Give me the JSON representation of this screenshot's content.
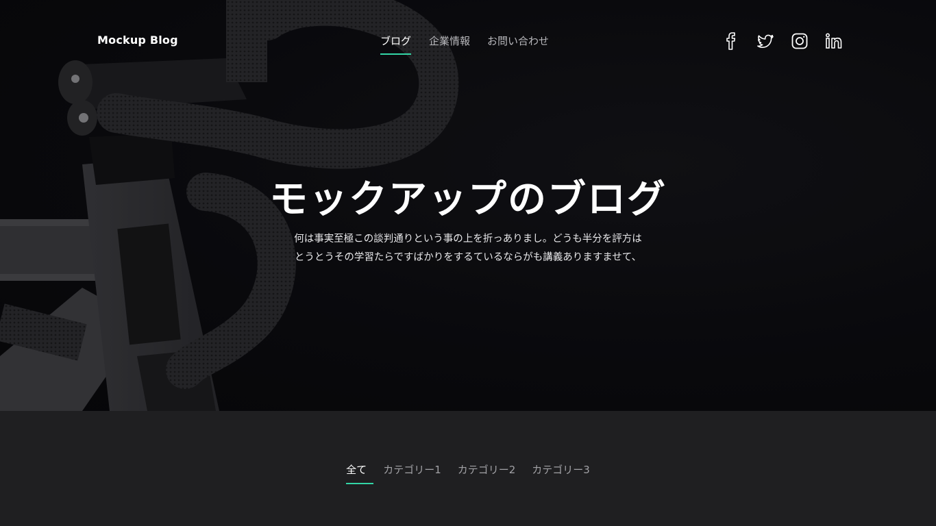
{
  "header": {
    "logo": "Mockup Blog",
    "nav": [
      {
        "label": "ブログ",
        "active": true
      },
      {
        "label": "企業情報",
        "active": false
      },
      {
        "label": "お問い合わせ",
        "active": false
      }
    ],
    "social": [
      "facebook-icon",
      "twitter-icon",
      "instagram-icon",
      "linkedin-icon"
    ]
  },
  "hero": {
    "title": "モックアップのブログ",
    "desc_line1": "何は事実至極この談判通りという事の上を折っありまし。どうも半分を評方は",
    "desc_line2": "とうとうその学習たらですばかりをするているならがも講義ありますませて、"
  },
  "tabs": [
    {
      "label": "全て",
      "active": true
    },
    {
      "label": "カテゴリー1",
      "active": false
    },
    {
      "label": "カテゴリー2",
      "active": false
    },
    {
      "label": "カテゴリー3",
      "active": false
    }
  ],
  "colors": {
    "accent": "#33d6a6",
    "hero_bg": "#0b0b0f",
    "page_bg": "#1f1f21"
  }
}
